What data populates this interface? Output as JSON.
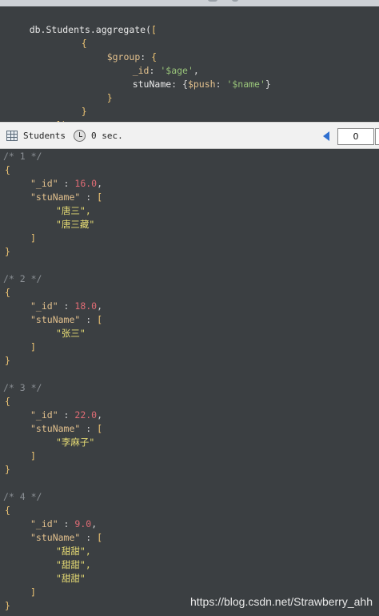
{
  "query": {
    "line1_obj": "db.Students.aggregate(",
    "line1_bracket": "[",
    "line2_brace": "{",
    "line3_key": "$group",
    "line3_colon": ": ",
    "line3_brace": "{",
    "line4_key": "_id",
    "line4_colon": ": ",
    "line4_value": "'$age'",
    "line4_comma": ",",
    "line5_key": "stuName",
    "line5_colon": ": {",
    "line5_push": "$push",
    "line5_colon2": ": ",
    "line5_value": "'$name'",
    "line5_close": "}",
    "line6_brace": "}",
    "line7_brace": "}",
    "line8_close": "])"
  },
  "toolbar": {
    "collection_label": "Students",
    "time_label": "0 sec.",
    "page_value": "0"
  },
  "results": [
    {
      "comment": "/* 1 */",
      "id_key": "\"_id\"",
      "id_value": "16.0",
      "names_key": "\"stuName\"",
      "names": [
        "\"唐三\",",
        "\"唐三藏\""
      ]
    },
    {
      "comment": "/* 2 */",
      "id_key": "\"_id\"",
      "id_value": "18.0",
      "names_key": "\"stuName\"",
      "names": [
        "\"张三\""
      ]
    },
    {
      "comment": "/* 3 */",
      "id_key": "\"_id\"",
      "id_value": "22.0",
      "names_key": "\"stuName\"",
      "names": [
        "\"李麻子\""
      ]
    },
    {
      "comment": "/* 4 */",
      "id_key": "\"_id\"",
      "id_value": "9.0",
      "names_key": "\"stuName\"",
      "names": [
        "\"甜甜\",",
        "\"甜甜\",",
        "\"甜甜\""
      ]
    }
  ],
  "symbols": {
    "open_brace": "{",
    "close_brace": "}",
    "colon": " : ",
    "comma": ",",
    "open_bracket": "[",
    "close_bracket": "]"
  },
  "watermark": "https://blog.csdn.net/Strawberry_ahh",
  "colors": {
    "background": "#3b3f42",
    "toolbar": "#f1f1f1",
    "number": "#e06c75",
    "string": "#e6db74",
    "key": "#e2c08d",
    "comment": "#8a8f94"
  }
}
